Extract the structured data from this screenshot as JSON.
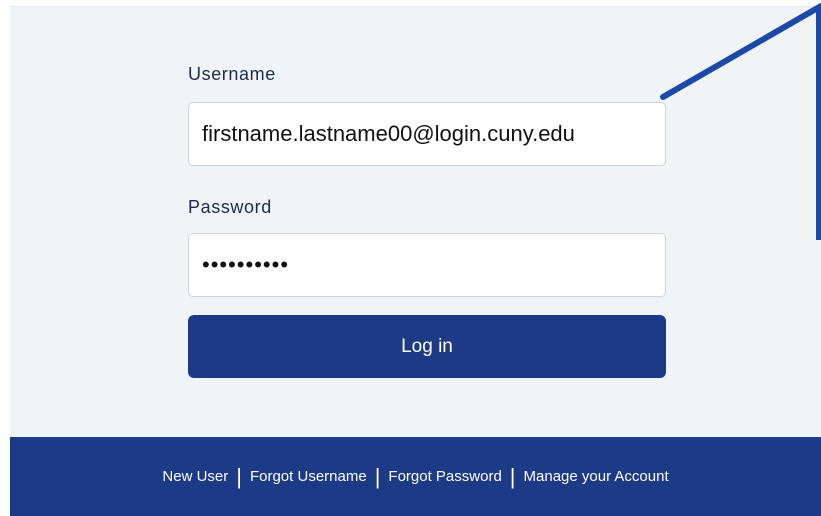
{
  "form": {
    "username_label": "Username",
    "username_value": "firstname.lastname00@login.cuny.edu",
    "password_label": "Password",
    "password_value": "••••••••••",
    "login_label": "Log in"
  },
  "footer": {
    "links": [
      {
        "label": "New User"
      },
      {
        "label": "Forgot Username"
      },
      {
        "label": "Forgot Password"
      },
      {
        "label": "Manage your Account"
      }
    ],
    "separator": "|"
  },
  "colors": {
    "primary": "#1c3a85",
    "card_background": "#f1f4f6",
    "annotation": "#1c49a8"
  }
}
